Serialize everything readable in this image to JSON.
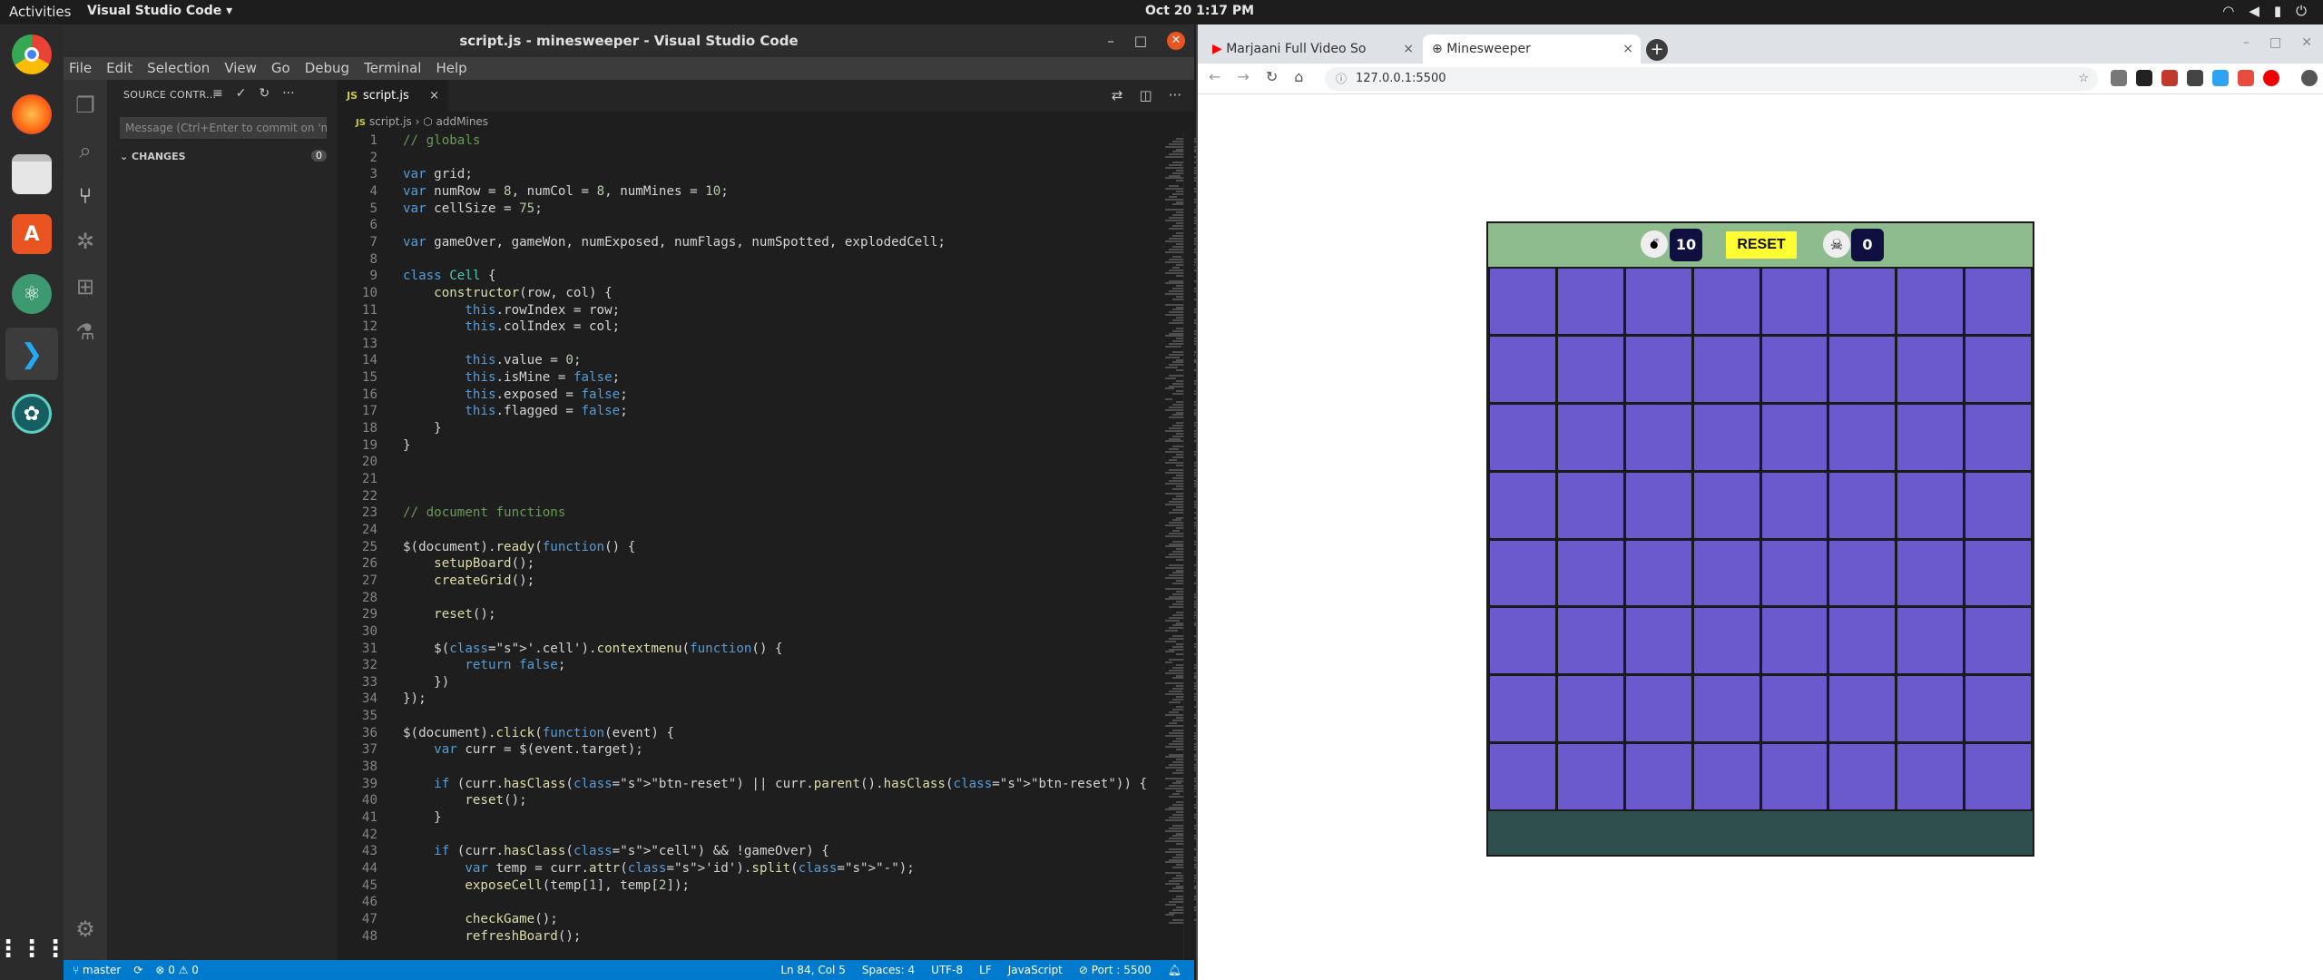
{
  "topbar": {
    "activities": "Activities",
    "app": "Visual Studio Code ▾",
    "clock": "Oct 20  1:17 PM"
  },
  "vscode": {
    "title": "script.js - minesweeper - Visual Studio Code",
    "menu": [
      "File",
      "Edit",
      "Selection",
      "View",
      "Go",
      "Debug",
      "Terminal",
      "Help"
    ],
    "sidebar": {
      "header": "SOURCE CONTR...",
      "message_placeholder": "Message (Ctrl+Enter to commit on 'ma",
      "changes_label": "CHANGES",
      "changes_count": "0"
    },
    "tab": {
      "icon": "JS",
      "label": "script.js",
      "close": "×"
    },
    "breadcrumb": {
      "file": "script.js",
      "symbol": "addMines"
    },
    "code": [
      "// globals",
      "",
      "var grid;",
      "var numRow = 8, numCol = 8, numMines = 10;",
      "var cellSize = 75;",
      "",
      "var gameOver, gameWon, numExposed, numFlags, numSpotted, explodedCell;",
      "",
      "class Cell {",
      "    constructor(row, col) {",
      "        this.rowIndex = row;",
      "        this.colIndex = col;",
      "",
      "        this.value = 0;",
      "        this.isMine = false;",
      "        this.exposed = false;",
      "        this.flagged = false;",
      "    }",
      "}",
      "",
      "",
      "",
      "// document functions",
      "",
      "$(document).ready(function() {",
      "    setupBoard();",
      "    createGrid();",
      "",
      "    reset();",
      "",
      "    $('.cell').contextmenu(function() {",
      "        return false;",
      "    })",
      "});",
      "",
      "$(document).click(function(event) {",
      "    var curr = $(event.target);",
      "",
      "    if (curr.hasClass(\"btn-reset\") || curr.parent().hasClass(\"btn-reset\")) {",
      "        reset();",
      "    }",
      "",
      "    if (curr.hasClass(\"cell\") && !gameOver) {",
      "        var temp = curr.attr('id').split(\"-\");",
      "        exposeCell(temp[1], temp[2]);",
      "",
      "        checkGame();",
      "        refreshBoard();"
    ],
    "status": {
      "branch": "master",
      "sync": "⟳",
      "problems": "⊗ 0 ⚠ 0",
      "position": "Ln 84, Col 5",
      "spaces": "Spaces: 4",
      "encoding": "UTF-8",
      "eol": "LF",
      "language": "JavaScript",
      "port": "⊘ Port : 5500"
    }
  },
  "chrome": {
    "tabs": [
      {
        "title": "Marjaani Full Video So",
        "close": "×"
      },
      {
        "title": "Minesweeper",
        "close": "×"
      }
    ],
    "plus": "+",
    "url": "127.0.0.1:5500"
  },
  "game": {
    "mine_count": "10",
    "reset_label": "RESET",
    "flag_count": "0",
    "rows": 8,
    "cols": 8
  },
  "colors": {
    "cell": "#6a5acd",
    "header": "#8fbc8f",
    "footer": "#2f4f4f",
    "reset_bg": "#ffff33",
    "vscode_status": "#007acc"
  },
  "icons": {
    "dock": [
      "chrome-icon",
      "firefox-icon",
      "files-icon",
      "software-center-icon",
      "atom-icon",
      "vscode-icon",
      "gitkraken-icon",
      "apps-grid-icon"
    ]
  }
}
